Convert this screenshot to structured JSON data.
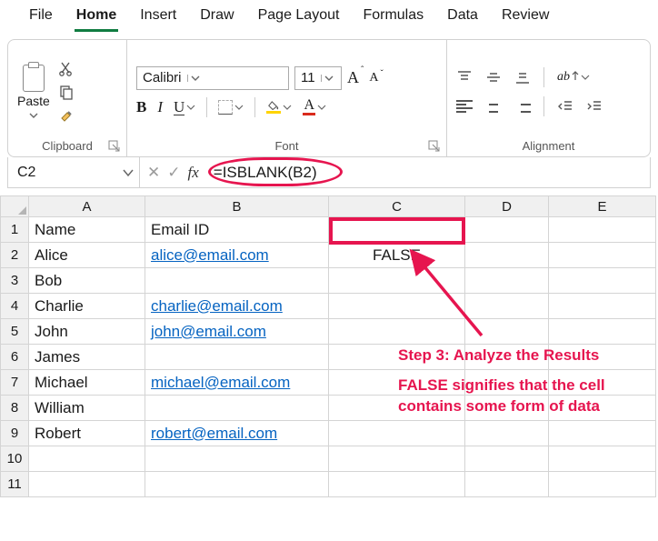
{
  "tabs": [
    "File",
    "Home",
    "Insert",
    "Draw",
    "Page Layout",
    "Formulas",
    "Data",
    "Review"
  ],
  "active_tab_index": 1,
  "ribbon": {
    "clipboard": {
      "title": "Clipboard",
      "paste": "Paste"
    },
    "font": {
      "title": "Font",
      "name": "Calibri",
      "size": "11",
      "bold": "B",
      "italic": "I",
      "underline": "U",
      "color_letter": "A"
    },
    "alignment": {
      "title": "Alignment"
    }
  },
  "namebox": "C2",
  "fx_label": "fx",
  "formula": "=ISBLANK(B2)",
  "columns": [
    "A",
    "B",
    "C",
    "D",
    "E"
  ],
  "rows": [
    {
      "n": "1",
      "A": "Name",
      "B": "Email ID",
      "C": "",
      "D": "",
      "E": ""
    },
    {
      "n": "2",
      "A": "Alice",
      "B": "alice@email.com",
      "C": "FALSE",
      "D": "",
      "E": "",
      "link": true
    },
    {
      "n": "3",
      "A": "Bob",
      "B": "",
      "C": "",
      "D": "",
      "E": ""
    },
    {
      "n": "4",
      "A": "Charlie",
      "B": "charlie@email.com",
      "C": "",
      "D": "",
      "E": "",
      "link": true
    },
    {
      "n": "5",
      "A": "John",
      "B": "john@email.com",
      "C": "",
      "D": "",
      "E": "",
      "link": true
    },
    {
      "n": "6",
      "A": "James",
      "B": "",
      "C": "",
      "D": "",
      "E": ""
    },
    {
      "n": "7",
      "A": "Michael",
      "B": "michael@email.com",
      "C": "",
      "D": "",
      "E": "",
      "link": true
    },
    {
      "n": "8",
      "A": "William",
      "B": "",
      "C": "",
      "D": "",
      "E": ""
    },
    {
      "n": "9",
      "A": "Robert",
      "B": "robert@email.com",
      "C": "",
      "D": "",
      "E": "",
      "link": true
    },
    {
      "n": "10",
      "A": "",
      "B": "",
      "C": "",
      "D": "",
      "E": ""
    },
    {
      "n": "11",
      "A": "",
      "B": "",
      "C": "",
      "D": "",
      "E": ""
    }
  ],
  "annotation": {
    "line1": "Step 3: Analyze the Results",
    "line2": "FALSE signifies that the cell",
    "line3": "contains some form of data"
  }
}
